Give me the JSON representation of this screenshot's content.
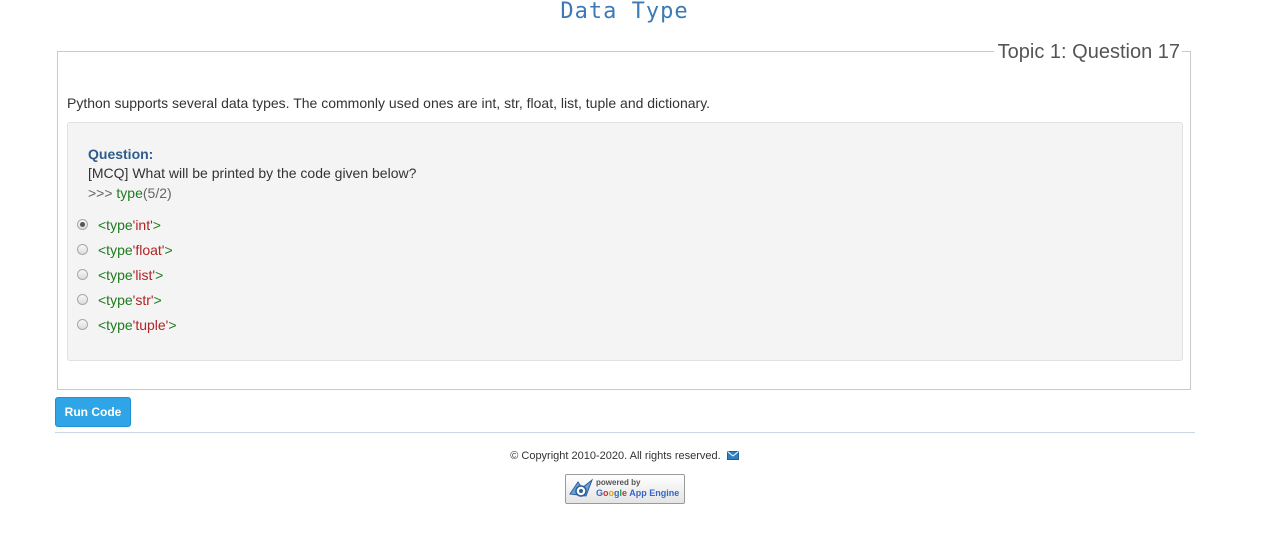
{
  "header": {
    "title": "Data Type"
  },
  "panel": {
    "legend": "Topic 1: Question 17",
    "intro": "Python supports several data types. The commonly used ones are int, str, float, list, tuple and dictionary."
  },
  "question": {
    "label": "Question:",
    "text": "[MCQ] What will be printed by the code given below?",
    "code": {
      "prompt": ">>> ",
      "keyword": "type",
      "args": "(5/2)"
    },
    "options": [
      {
        "prefix": "<type ",
        "value": "'int'",
        "suffix": ">",
        "selected": true
      },
      {
        "prefix": "<type ",
        "value": "'float'",
        "suffix": ">",
        "selected": false
      },
      {
        "prefix": "<type ",
        "value": "'list'",
        "suffix": ">",
        "selected": false
      },
      {
        "prefix": "<type ",
        "value": "'str'",
        "suffix": ">",
        "selected": false
      },
      {
        "prefix": "<type ",
        "value": "'tuple'",
        "suffix": ">",
        "selected": false
      }
    ]
  },
  "actions": {
    "run_label": "Run Code"
  },
  "footer": {
    "copyright": "© Copyright 2010-2020. All rights reserved.",
    "mail_icon": "envelope-icon"
  },
  "badge": {
    "powered": "powered by",
    "google": [
      "G",
      "o",
      "o",
      "g",
      "l",
      "e"
    ],
    "product": "App Engine"
  },
  "colors": {
    "title": "#3a7ab8",
    "question_label": "#2f5c8a",
    "keyword": "#1f7a1f",
    "string": "#b22222",
    "button": "#2fa4e7"
  }
}
